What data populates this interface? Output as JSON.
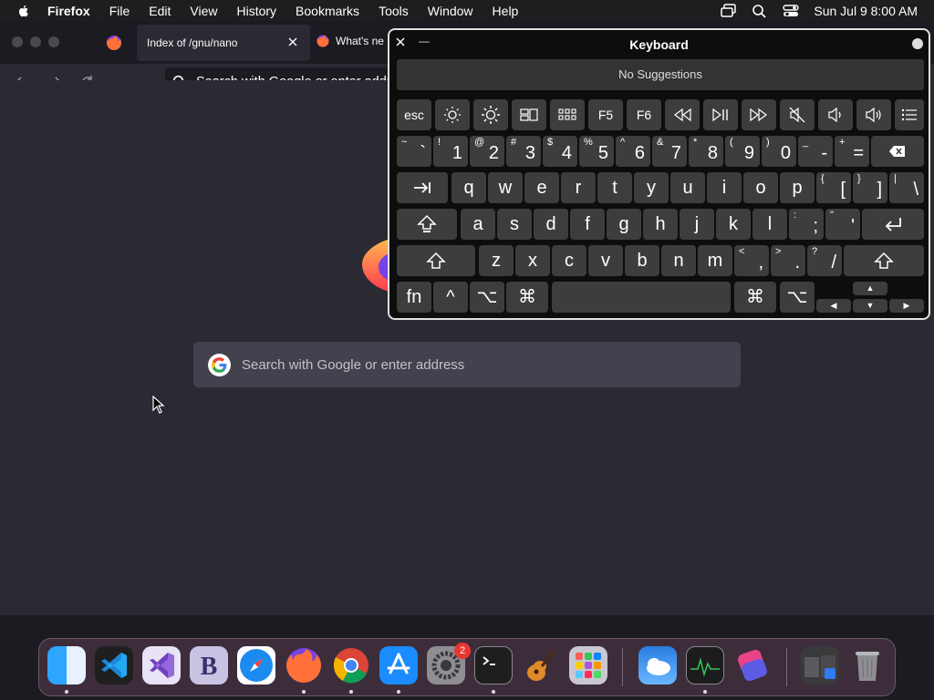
{
  "menubar": {
    "app_name": "Firefox",
    "items": [
      "File",
      "Edit",
      "View",
      "History",
      "Bookmarks",
      "Tools",
      "Window",
      "Help"
    ],
    "datetime": "Sun Jul 9  8:00 AM"
  },
  "browser": {
    "tabs": [
      {
        "title": "Index of /gnu/nano"
      },
      {
        "title": "What's ne"
      }
    ],
    "urlbar_placeholder": "Search with Google or enter address",
    "content_search_placeholder": "Search with Google or enter address"
  },
  "keyboard_viewer": {
    "title": "Keyboard",
    "suggestions_text": "No Suggestions",
    "function_row": [
      "esc",
      "brightness-down-icon",
      "brightness-up-icon",
      "mission-control-icon",
      "launchpad-icon",
      "F5",
      "F6",
      "rewind-icon",
      "play-pause-icon",
      "fast-forward-icon",
      "mute-icon",
      "volume-down-icon",
      "volume-up-icon",
      "list-icon"
    ],
    "number_row": [
      {
        "shift": "~",
        "main": "`"
      },
      {
        "shift": "!",
        "main": "1"
      },
      {
        "shift": "@",
        "main": "2"
      },
      {
        "shift": "#",
        "main": "3"
      },
      {
        "shift": "$",
        "main": "4"
      },
      {
        "shift": "%",
        "main": "5"
      },
      {
        "shift": "^",
        "main": "6"
      },
      {
        "shift": "&",
        "main": "7"
      },
      {
        "shift": "*",
        "main": "8"
      },
      {
        "shift": "(",
        "main": "9"
      },
      {
        "shift": ")",
        "main": "0"
      },
      {
        "shift": "_",
        "main": "-"
      },
      {
        "shift": "+",
        "main": "="
      }
    ],
    "qwerty_row": [
      "q",
      "w",
      "e",
      "r",
      "t",
      "y",
      "u",
      "i",
      "o",
      "p"
    ],
    "qwerty_row_symbols": [
      {
        "shift": "{",
        "main": "["
      },
      {
        "shift": "}",
        "main": "]"
      },
      {
        "shift": "|",
        "main": "\\"
      }
    ],
    "home_row": [
      "a",
      "s",
      "d",
      "f",
      "g",
      "h",
      "j",
      "k",
      "l"
    ],
    "home_row_symbols": [
      {
        "shift": ":",
        "main": ";"
      },
      {
        "shift": "\"",
        "main": "'"
      }
    ],
    "bottom_row": [
      "z",
      "x",
      "c",
      "v",
      "b",
      "n",
      "m"
    ],
    "bottom_row_symbols": [
      {
        "shift": "<",
        "main": ","
      },
      {
        "shift": ">",
        "main": "."
      },
      {
        "shift": "?",
        "main": "/"
      }
    ],
    "modifiers": {
      "fn": "fn",
      "control": "^",
      "option": "⌥",
      "command": "⌘"
    },
    "arrows": {
      "up": "▲",
      "left": "◀",
      "down": "▼",
      "right": "▶"
    }
  },
  "dock": {
    "items": [
      "finder-icon",
      "vscode-icon",
      "visual-studio-icon",
      "bbedit-icon",
      "safari-icon",
      "firefox-icon",
      "chrome-icon",
      "app-store-icon",
      "system-settings-icon",
      "terminal-icon",
      "garageband-icon",
      "launchpad-icon",
      "weather-icon",
      "activity-monitor-icon",
      "shortcuts-icon",
      "downloads-stack-icon",
      "trash-icon"
    ],
    "settings_badge": "2"
  },
  "colors": {
    "accent": "#0a84ff",
    "firefox_orange": "#ff7139"
  }
}
